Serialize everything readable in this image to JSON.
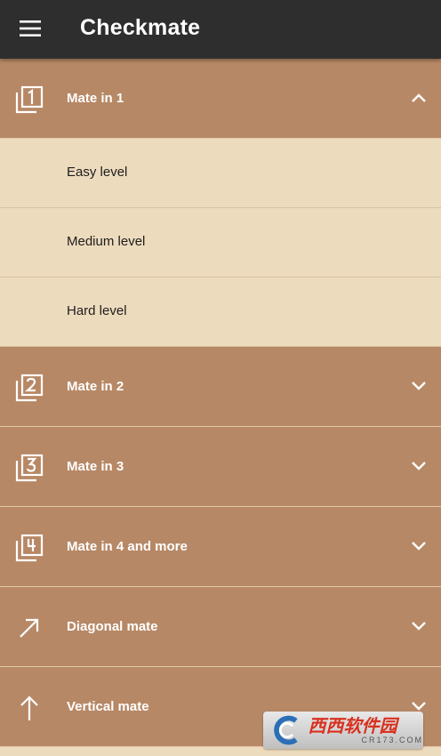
{
  "app": {
    "title": "Checkmate",
    "colors": {
      "appbar": "#2e2e2e",
      "section": "#b78866",
      "subitem": "#eddbbd",
      "text_light": "#ffffff",
      "text_dark": "#1d1d1d"
    }
  },
  "sections": [
    {
      "label": "Mate in 1",
      "icon": "square-1-icon",
      "expanded": true,
      "items": [
        {
          "label": "Easy level"
        },
        {
          "label": "Medium level"
        },
        {
          "label": "Hard level"
        }
      ]
    },
    {
      "label": "Mate in 2",
      "icon": "square-2-icon",
      "expanded": false
    },
    {
      "label": "Mate in 3",
      "icon": "square-3-icon",
      "expanded": false
    },
    {
      "label": "Mate in 4 and more",
      "icon": "square-4-icon",
      "expanded": false
    },
    {
      "label": "Diagonal mate",
      "icon": "diagonal-arrow-icon",
      "expanded": false
    },
    {
      "label": "Vertical mate",
      "icon": "up-arrow-icon",
      "expanded": false
    }
  ],
  "watermark": {
    "text": "西西软件园",
    "url_text": "CR173.COM"
  }
}
